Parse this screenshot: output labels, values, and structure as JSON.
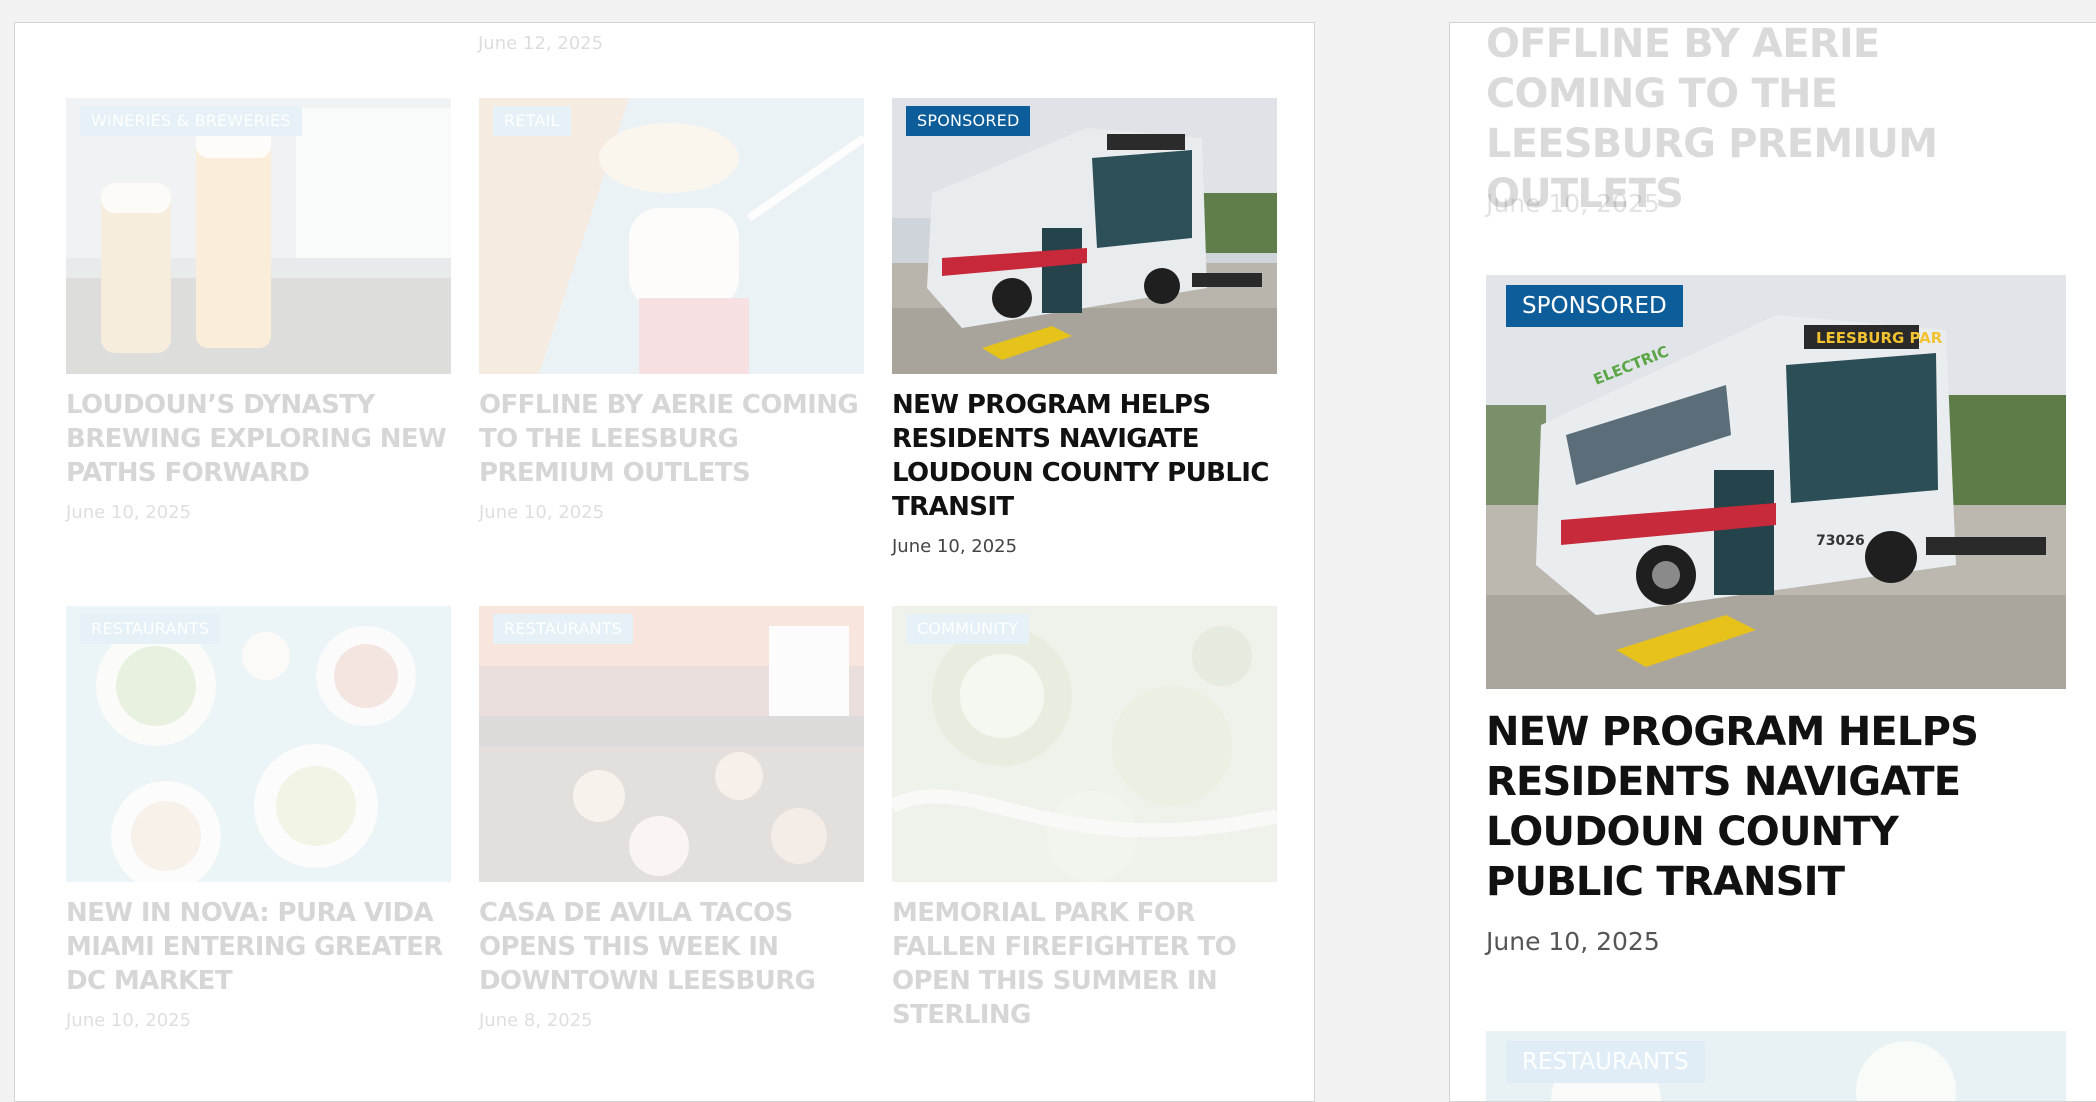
{
  "grid": {
    "top_date": "June 12, 2025",
    "cards": [
      {
        "category": "WINERIES & BREWERIES",
        "title": "LOUDOUN’S DYNASTY BREWING EXPLORING NEW PATHS FORWARD",
        "date": "June 10, 2025"
      },
      {
        "category": "RETAIL",
        "title": "OFFLINE BY AERIE COMING TO THE LEESBURG PREMIUM OUTLETS",
        "date": "June 10, 2025"
      },
      {
        "category": "SPONSORED",
        "title": "NEW PROGRAM HELPS RESIDENTS NAVIGATE LOUDOUN COUNTY PUBLIC TRANSIT",
        "date": "June 10, 2025"
      },
      {
        "category": "RESTAURANTS",
        "title": "NEW IN NOVA: PURA VIDA MIAMI ENTERING GREATER DC MARKET",
        "date": "June 10, 2025"
      },
      {
        "category": "RESTAURANTS",
        "title": "CASA DE AVILA TACOS OPENS THIS WEEK IN DOWNTOWN LEESBURG",
        "date": "June 8, 2025"
      },
      {
        "category": "COMMUNITY",
        "title": "MEMORIAL PARK FOR FALLEN FIREFIGHTER TO OPEN THIS SUMMER IN STERLING",
        "date": ""
      }
    ]
  },
  "sidebar": {
    "prev_title": "OFFLINE BY AERIE COMING TO THE LEESBURG PREMIUM OUTLETS",
    "prev_date": "June 10, 2025",
    "featured": {
      "category": "SPONSORED",
      "title": "NEW PROGRAM HELPS RESIDENTS NAVIGATE LOUDOUN COUNTY PUBLIC TRANSIT",
      "date": "June 10, 2025",
      "bus_sign": "LEESBURG PAR",
      "bus_number": "73026",
      "bus_side": "ELECTRIC"
    },
    "next_category": "RESTAURANTS"
  },
  "colors": {
    "badge_blue": "#0e5d9b",
    "badge_light": "#6aa8d6",
    "title": "#111111"
  }
}
